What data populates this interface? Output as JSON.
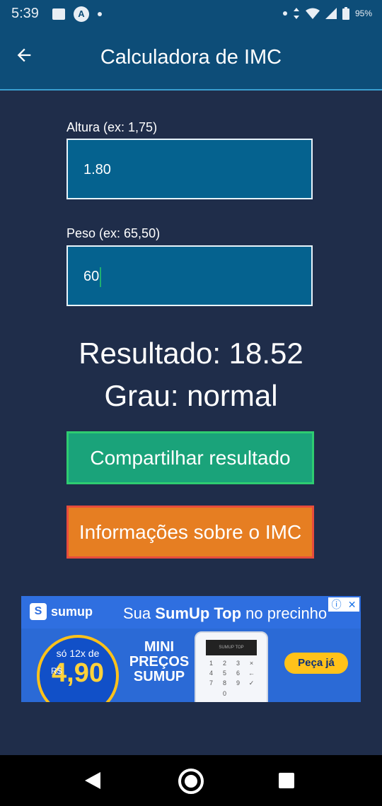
{
  "status_bar": {
    "time": "5:39",
    "battery": "95%",
    "app_badge": "A"
  },
  "app_bar": {
    "title": "Calculadora de IMC"
  },
  "form": {
    "height_label": "Altura (ex: 1,75)",
    "height_value": "1.80",
    "weight_label": "Peso (ex: 65,50)",
    "weight_value": "60"
  },
  "result": {
    "result_text": "Resultado: 18.52",
    "grade_text": "Grau: normal"
  },
  "buttons": {
    "share_label": "Compartilhar resultado",
    "info_label": "Informações sobre o IMC"
  },
  "ad": {
    "brand": "sumup",
    "headline_prefix": "Sua ",
    "headline_bold": "SumUp Top",
    "headline_suffix": " no precinho",
    "installments": "só 12x de",
    "currency": "R$",
    "price": "4,90",
    "mini_line1": "MINI",
    "mini_line2": "PREÇOS",
    "mini_line3": "SUMUP",
    "cta": "Peça já",
    "device_screen": "SUMUP TOP",
    "keys": [
      "1",
      "2",
      "3",
      "×",
      "4",
      "5",
      "6",
      "←",
      "7",
      "8",
      "9",
      "✓",
      "",
      "0",
      "",
      ""
    ]
  },
  "colors": {
    "background": "#1f2d4a",
    "app_bar": "#0d4d78",
    "field": "#05628f",
    "share_button": "#1aa37a",
    "share_border": "#2ecc71",
    "info_button": "#e67e22",
    "info_border": "#e74c3c"
  }
}
